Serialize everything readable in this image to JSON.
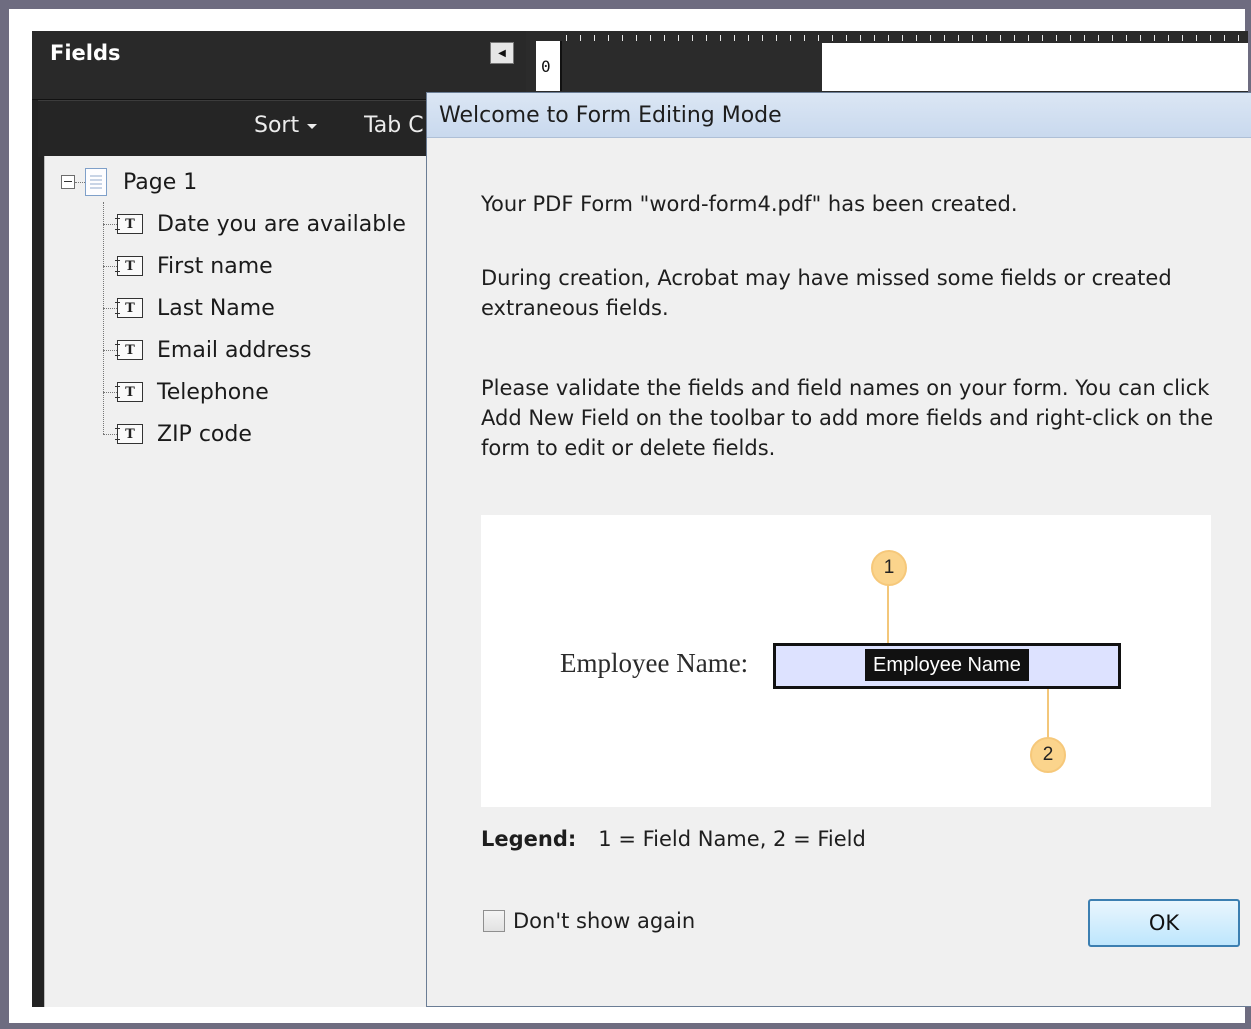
{
  "fields_panel": {
    "title": "Fields",
    "toolbar": {
      "sort_label": "Sort",
      "tab_order_label": "Tab C"
    },
    "tree": {
      "root_label": "Page 1",
      "items": [
        {
          "label": "Date you are available",
          "icon": "text-field-icon"
        },
        {
          "label": "First name",
          "icon": "text-field-icon"
        },
        {
          "label": "Last Name",
          "icon": "text-field-icon"
        },
        {
          "label": "Email address",
          "icon": "text-field-icon"
        },
        {
          "label": "Telephone",
          "icon": "text-field-icon"
        },
        {
          "label": "ZIP code",
          "icon": "text-field-icon"
        }
      ]
    }
  },
  "ruler": {
    "zero_label": "0"
  },
  "dialog": {
    "title": "Welcome to Form Editing Mode",
    "paragraph1": "Your PDF Form \"word-form4.pdf\" has been created.",
    "paragraph2": "During creation, Acrobat may have missed some fields or created extraneous fields.",
    "paragraph3": "Please validate the fields and field names on your form. You can click Add New Field on the toolbar to add more fields and right-click on the form to edit or delete fields.",
    "illustration": {
      "label_text": "Employee Name:",
      "field_name_text": "Employee Name",
      "callout1": "1",
      "callout2": "2"
    },
    "legend_label": "Legend:",
    "legend_text": "1 = Field Name, 2 = Field",
    "dont_show_label": "Don't show again",
    "ok_label": "OK"
  },
  "colors": {
    "panel_dark": "#2b2b2b",
    "dialog_bg": "#f0f0f0",
    "title_bar": "#c9d9ee",
    "callout": "#fbd48c",
    "field_fill": "#dde2ff"
  }
}
